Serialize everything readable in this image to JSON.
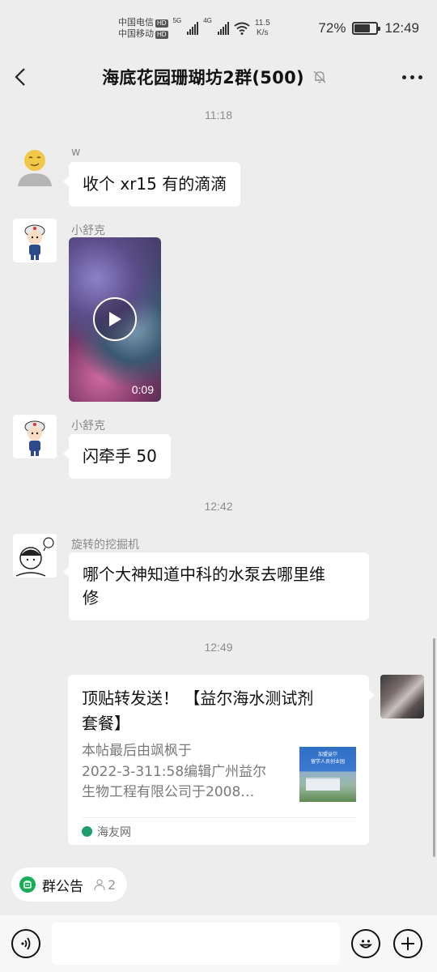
{
  "status_bar": {
    "carrier_1": "中国电信",
    "carrier_2": "中国移动",
    "hd": "HD",
    "net_1": "5G",
    "net_2": "4G",
    "speed_value": "11.5",
    "speed_unit": "K/s",
    "battery_percent": "72%",
    "battery_level": 0.72,
    "time": "12:49"
  },
  "header": {
    "title": "海底花园珊瑚坊2群(500)",
    "back_icon": "chevron-left-icon",
    "mute_icon": "bell-muted-icon",
    "more_icon": "more-dots-icon"
  },
  "chat": {
    "timestamps": [
      "11:18",
      "12:42",
      "12:49"
    ],
    "messages": [
      {
        "sender": "w",
        "text": "收个 xr15 有的滴滴"
      },
      {
        "sender": "小舒克",
        "type": "video",
        "duration": "0:09"
      },
      {
        "sender": "小舒克",
        "text": "闪牵手 50"
      },
      {
        "sender": "旋转的挖掘机",
        "text_line_1": "哪个大神知道中科的水泵去哪里维",
        "text_line_2": "修"
      }
    ],
    "link_card": {
      "title_line_1": "顶贴转发送！ 【益尔海水测试剂",
      "title_line_2": "套餐】",
      "desc_line_1": "本帖最后由飒枫于",
      "desc_line_2": "2022-3-311:58编辑广州益尔",
      "desc_line_3": "生物工程有限公司于2008…",
      "thumb_text_1": "加盟益尔",
      "thumb_text_2": "留学人员创业园",
      "source": "海友网"
    }
  },
  "bottom": {
    "notice_label": "群公告",
    "notice_count": "2",
    "voice_icon": "voice-icon",
    "emoji_icon": "emoji-icon",
    "plus_icon": "plus-icon"
  }
}
